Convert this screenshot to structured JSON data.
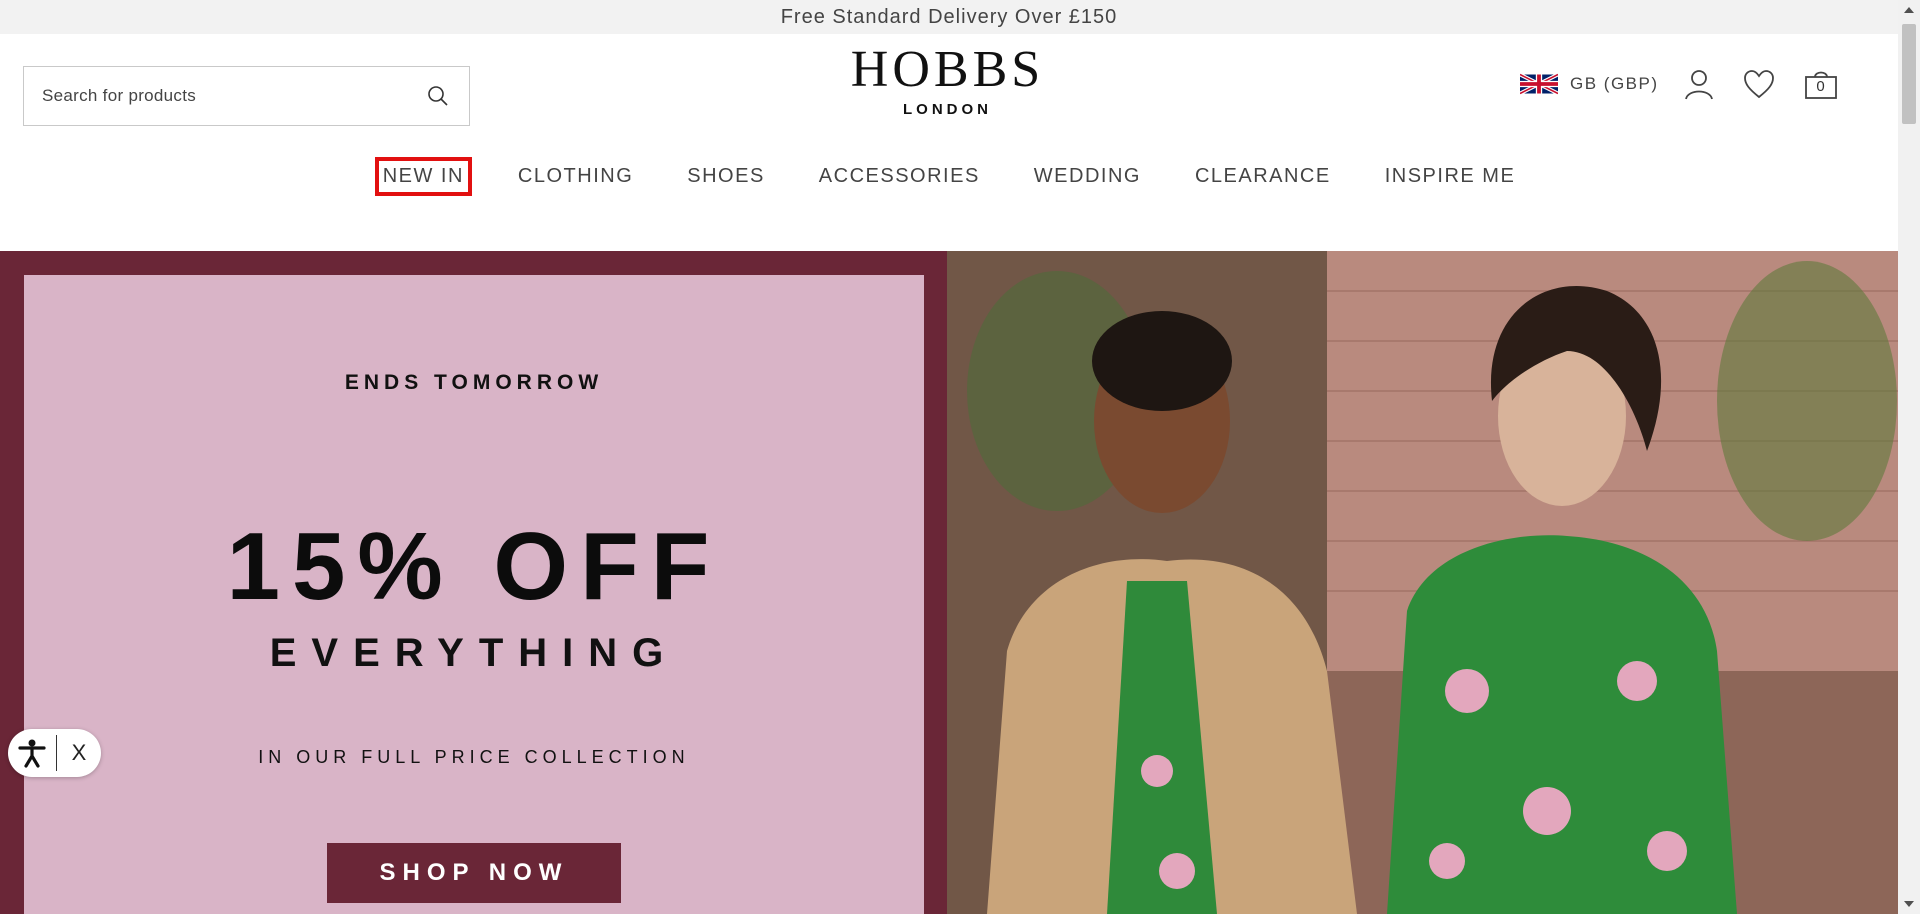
{
  "promo_bar": {
    "text": "Free Standard Delivery Over £150"
  },
  "search": {
    "placeholder": "Search for products",
    "value": ""
  },
  "logo": {
    "main": "HOBBS",
    "sub": "LONDON"
  },
  "utility": {
    "locale": "GB (GBP)",
    "bag_count": "0",
    "icons": [
      "uk-flag-icon",
      "account-icon",
      "heart-icon",
      "bag-icon"
    ]
  },
  "nav": {
    "items": [
      {
        "label": "NEW IN",
        "highlighted": true
      },
      {
        "label": "CLOTHING"
      },
      {
        "label": "SHOES"
      },
      {
        "label": "ACCESSORIES"
      },
      {
        "label": "WEDDING"
      },
      {
        "label": "CLEARANCE"
      },
      {
        "label": "INSPIRE ME"
      }
    ]
  },
  "hero": {
    "eyebrow": "ENDS TOMORROW",
    "headline": "15% OFF",
    "subheadline": "EVERYTHING",
    "detail": "IN OUR FULL PRICE COLLECTION",
    "cta": "SHOP NOW"
  },
  "accessibility_widget": {
    "close_label": "X"
  },
  "colors": {
    "brand_burgundy": "#6a2637",
    "panel_pink": "#d9b4c7",
    "highlight_red": "#e21010",
    "promo_bar_bg": "#f2f2f2"
  }
}
